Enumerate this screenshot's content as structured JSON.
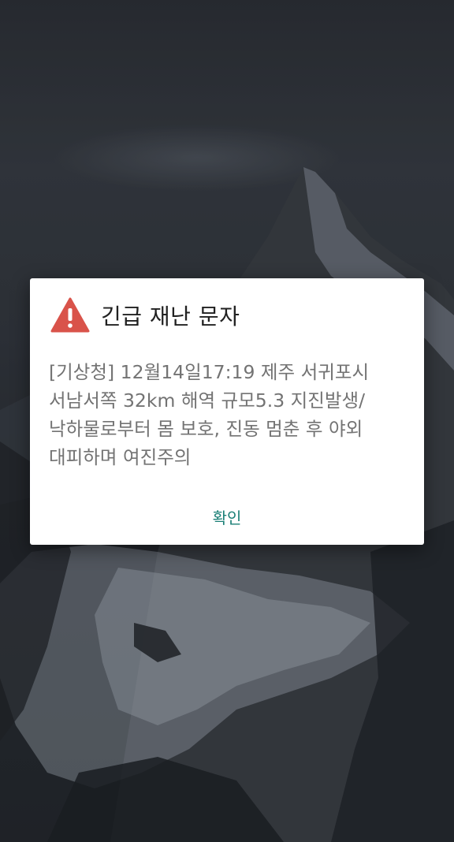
{
  "alert": {
    "title": "긴급 재난 문자",
    "message": "[기상청] 12월14일17:19 제주 서귀포시\n서남서쪽 32km 해역 규모5.3 지진발생/\n낙하물로부터 몸 보호, 진동 멈춘 후 야외\n대피하며 여진주의",
    "confirm_label": "확인",
    "icon": "warning-icon"
  },
  "colors": {
    "warning_icon": "#d9534a",
    "confirm_text": "#1a7f76",
    "dialog_background": "#ffffff"
  }
}
